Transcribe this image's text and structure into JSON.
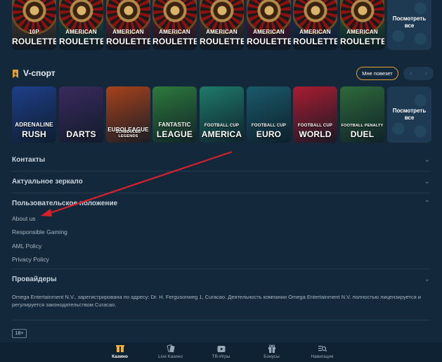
{
  "top_row": {
    "tiles": [
      {
        "line1": "10P",
        "line2": "ROULETTE",
        "bg": "#6b4a2e"
      },
      {
        "line1": "AMERICAN",
        "line2": "ROULETTE",
        "bg": "#1f5c46"
      },
      {
        "line1": "AMERICAN",
        "line2": "ROULETTE",
        "bg": "#8a1c26"
      },
      {
        "line1": "AMERICAN",
        "line2": "ROULETTE",
        "bg": "#7a1a22"
      },
      {
        "line1": "AMERICAN",
        "line2": "ROULETTE",
        "bg": "#5a3a30"
      },
      {
        "line1": "AMERICAN",
        "line2": "ROULETTE",
        "bg": "#7a1030"
      },
      {
        "line1": "AMERICAN",
        "line2": "ROULETTE",
        "bg": "#2a3560"
      },
      {
        "line1": "AMERICAN",
        "line2": "ROULETTE",
        "bg": "#2d6b3a"
      }
    ],
    "more_label": "Посмотреть все"
  },
  "vsport": {
    "title": "V-спорт",
    "lucky_label": "Мне повезет",
    "prev_icon": "chevron-left-icon",
    "next_icon": "chevron-right-icon",
    "tiles": [
      {
        "line1": "ADRENALINE",
        "line2": "RUSH",
        "bg": "#1e3f8a"
      },
      {
        "line1": "",
        "line2": "DARTS",
        "bg": "#3a2a5e"
      },
      {
        "line1": "EUROLEAGUE",
        "line2": "SCHEDULED LEGENDS",
        "bg": "#a8421c"
      },
      {
        "line1": "FANTASTIC",
        "line2": "LEAGUE",
        "bg": "#2e7a3c"
      },
      {
        "line1": "FOOTBALL CUP",
        "line2": "AMERICA",
        "bg": "#1f7a6a"
      },
      {
        "line1": "FOOTBALL CUP",
        "line2": "EURO",
        "bg": "#1a5a6a"
      },
      {
        "line1": "FOOTBALL CUP",
        "line2": "WORLD",
        "bg": "#a81c30"
      },
      {
        "line1": "FOOTBALL PENALTY",
        "line2": "DUEL",
        "bg": "#2e6a3a"
      }
    ],
    "more_label": "Посмотреть все"
  },
  "footer": {
    "contacts": "Контакты",
    "mirror": "Актуальное зеркало",
    "terms": "Пользовательское положение",
    "links": [
      "About us",
      "Responsible Gaming",
      "AML Policy",
      "Privacy Policy"
    ],
    "providers": "Провайдеры",
    "legal_text": "Omega Entertainment N.V., зарегистрирована по адресу: Dr. H. Fergusonweg 1, Curacao. Деятельность компании Omega Entertainment N.V. полностью лицензируется и регулируется законодательством Curacao.",
    "age_badge": "18+"
  },
  "bottom_nav": [
    {
      "label": "Казино",
      "icon": "casino-icon",
      "glyph": "♣",
      "active": true
    },
    {
      "label": "Live Казино",
      "icon": "cards-icon",
      "glyph": "🂡",
      "active": false
    },
    {
      "label": "ТВ-Игры",
      "icon": "tv-play-icon",
      "glyph": "▶",
      "active": false
    },
    {
      "label": "Бонусы",
      "icon": "gift-icon",
      "glyph": "🎁",
      "active": false
    },
    {
      "label": "Навигация",
      "icon": "navigation-search-icon",
      "glyph": "☰",
      "active": false
    }
  ],
  "colors": {
    "accent": "#e0a232",
    "background": "#13283a",
    "annotation_arrow": "#d8202a"
  }
}
